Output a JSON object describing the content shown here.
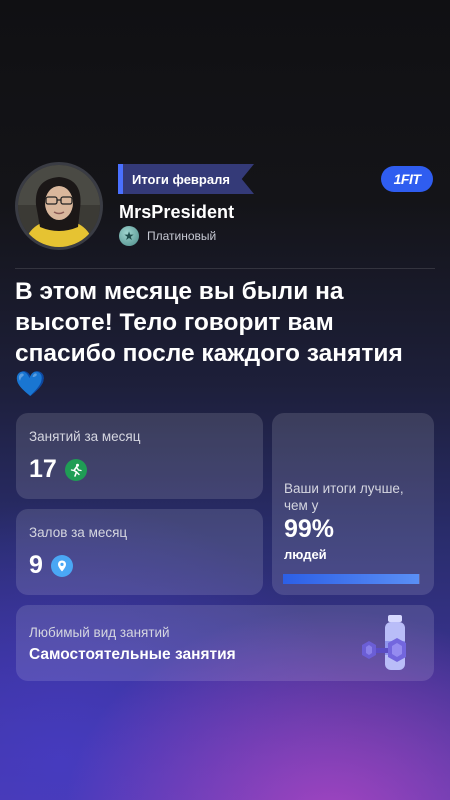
{
  "header": {
    "month_badge": "Итоги февраля",
    "username": "MrsPresident",
    "tier": "Платиновый",
    "logo": "1FIT",
    "avatar_icon": "user-avatar-photo"
  },
  "headline": {
    "text": "В этом месяце вы были на высоте! Тело говорит вам спасибо после каждого занятия",
    "emoji": "💙"
  },
  "stats": {
    "workouts": {
      "label": "Занятий за месяц",
      "value": "17",
      "icon": "running-icon"
    },
    "gyms": {
      "label": "Залов за месяц",
      "value": "9",
      "icon": "location-pin-icon"
    }
  },
  "result": {
    "text": "Ваши итоги лучше, чем у",
    "percent": "99%",
    "people": "людей",
    "progress": 0.99
  },
  "favorite": {
    "title": "Любимый вид занятий",
    "value": "Самостоятельные занятия",
    "icon": "dumbbell-bottle-illustration"
  },
  "colors": {
    "accent": "#2f5df0",
    "badge_bg": "#343a78",
    "badge_stripe": "#4a70ff",
    "run_icon": "#1f9d55",
    "pin_icon": "#4aa7f5"
  }
}
